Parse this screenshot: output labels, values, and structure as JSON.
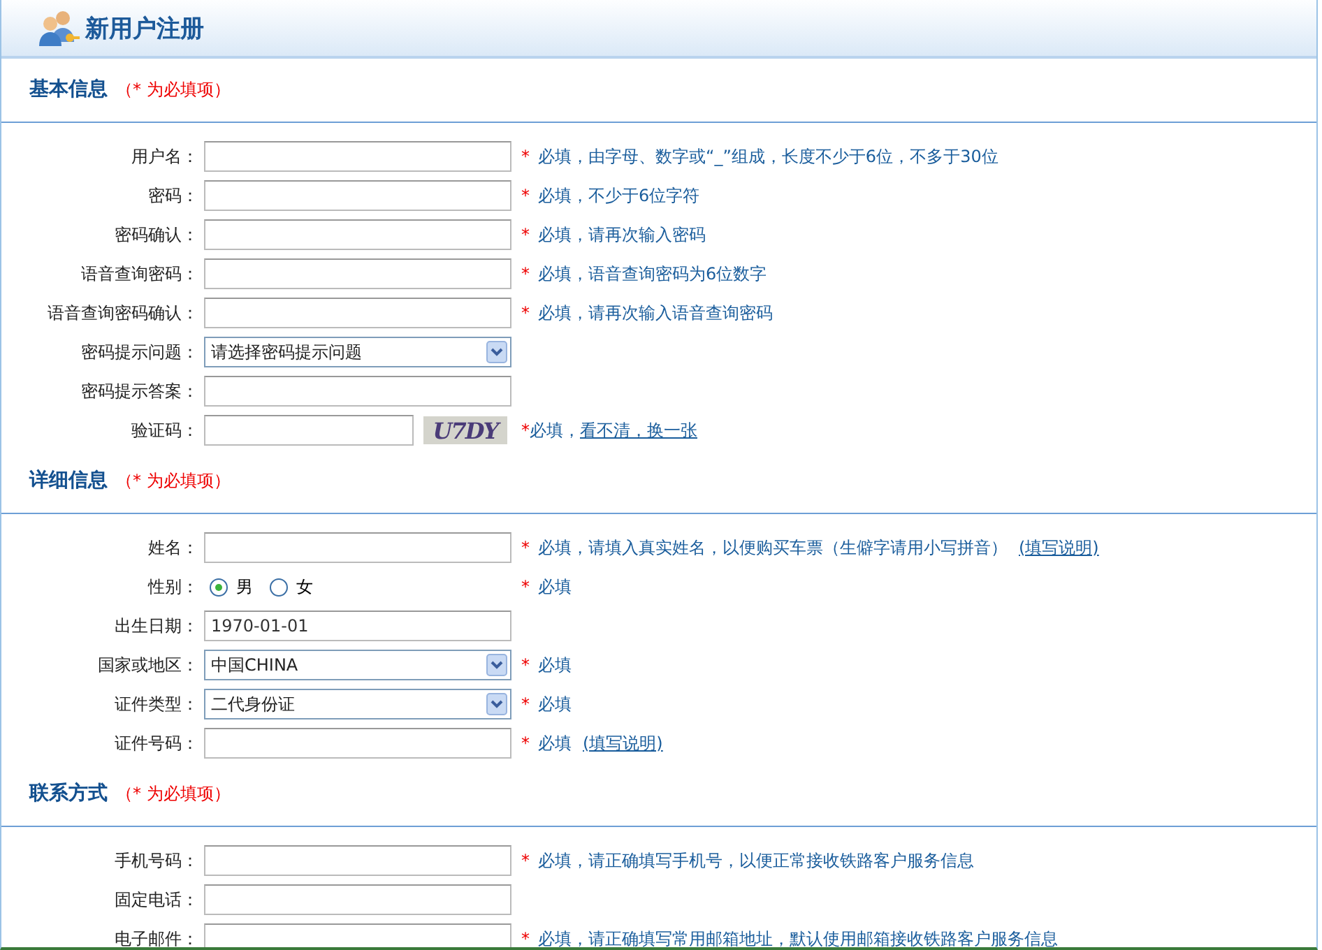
{
  "header": {
    "title": "新用户注册"
  },
  "sections": [
    {
      "title": "基本信息",
      "required_note": "（* 为必填项）",
      "rows": [
        {
          "label": "用户名：",
          "kind": "text",
          "hint": {
            "star": "*",
            "text": "必填，由字母、数字或“_”组成，长度不少于6位，不多于30位"
          }
        },
        {
          "label": "密码：",
          "kind": "text",
          "hint": {
            "star": "*",
            "text": "必填，不少于6位字符"
          }
        },
        {
          "label": "密码确认：",
          "kind": "text",
          "hint": {
            "star": "*",
            "text": "必填，请再次输入密码"
          }
        },
        {
          "label": "语音查询密码：",
          "kind": "text",
          "hint": {
            "star": "*",
            "text": "必填，语音查询密码为6位数字"
          }
        },
        {
          "label": "语音查询密码确认：",
          "kind": "text",
          "hint": {
            "star": "*",
            "text": "必填，请再次输入语音查询密码"
          }
        },
        {
          "label": "密码提示问题：",
          "kind": "select",
          "value": "请选择密码提示问题"
        },
        {
          "label": "密码提示答案：",
          "kind": "text"
        },
        {
          "label": "验证码：",
          "kind": "captcha",
          "captcha": "U7DY",
          "hint": {
            "star": "*",
            "text": "必填，",
            "link": "看不清，换一张"
          }
        }
      ]
    },
    {
      "title": "详细信息",
      "required_note": "（* 为必填项）",
      "rows": [
        {
          "label": "姓名：",
          "kind": "text",
          "hint": {
            "star": "*",
            "text": "必填，请填入真实姓名，以便购买车票（生僻字请用小写拼音）",
            "link": "(填写说明)"
          }
        },
        {
          "label": "性别：",
          "kind": "radio",
          "options": [
            {
              "label": "男",
              "selected": true
            },
            {
              "label": "女",
              "selected": false
            }
          ],
          "hint": {
            "star": "*",
            "text": "必填"
          }
        },
        {
          "label": "出生日期：",
          "kind": "text",
          "value": "1970-01-01"
        },
        {
          "label": "国家或地区：",
          "kind": "select",
          "value": "中国CHINA",
          "hint": {
            "star": "*",
            "text": "必填"
          }
        },
        {
          "label": "证件类型：",
          "kind": "select",
          "value": "二代身份证",
          "hint": {
            "star": "*",
            "text": "必填"
          }
        },
        {
          "label": "证件号码：",
          "kind": "text",
          "hint": {
            "star": "*",
            "text": "必填",
            "link": "(填写说明)"
          }
        }
      ]
    },
    {
      "title": "联系方式",
      "required_note": "（* 为必填项）",
      "rows": [
        {
          "label": "手机号码：",
          "kind": "text",
          "hint": {
            "star": "*",
            "text": "必填，请正确填写手机号，以便正常接收铁路客户服务信息"
          }
        },
        {
          "label": "固定电话：",
          "kind": "text"
        },
        {
          "label": "电子邮件：",
          "kind": "text",
          "hint": {
            "star": "*",
            "text": "必填，请正确填写常用邮箱地址，默认使用邮箱接收铁路客户服务信息"
          }
        }
      ]
    }
  ]
}
